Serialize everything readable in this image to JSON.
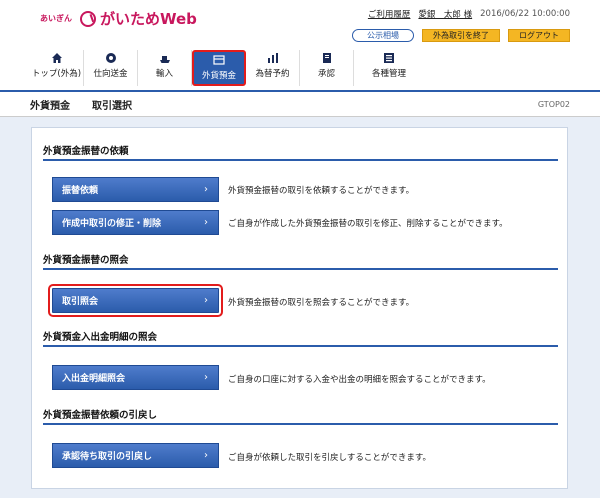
{
  "header": {
    "logo_small": "あいぎん",
    "logo_main": "がいためWeb",
    "history_link": "ご利用履歴",
    "user_name": "愛銀　太郎 様",
    "datetime": "2016/06/22 10:00:00",
    "rates_button": "公示相場",
    "end_fx_button": "外為取引を終了",
    "logout_button": "ログアウト"
  },
  "nav": {
    "items": [
      {
        "label": "トップ(外為)",
        "icon": "home-icon"
      },
      {
        "label": "仕向送金",
        "icon": "remittance-icon"
      },
      {
        "label": "輸入",
        "icon": "import-ship-icon"
      },
      {
        "label": "外貨預金",
        "icon": "deposit-icon"
      },
      {
        "label": "為替予約",
        "icon": "fx-contract-icon"
      },
      {
        "label": "承認",
        "icon": "approval-icon"
      },
      {
        "label": "各種管理",
        "icon": "management-icon"
      }
    ],
    "active_index": 3,
    "active_color": "#2b5cab",
    "highlight_color": "#e21c1c"
  },
  "title": {
    "section": "外貨預金",
    "page": "取引選択",
    "code": "GTOP02"
  },
  "sections": [
    {
      "title": "外貨預金振替の依頼",
      "actions": [
        {
          "label": "振替依頼",
          "desc": "外貨預金振替の取引を依頼することができます。"
        },
        {
          "label": "作成中取引の修正・削除",
          "desc": "ご自身が作成した外貨預金振替の取引を修正、削除することができます。"
        }
      ]
    },
    {
      "title": "外貨預金振替の照会",
      "actions": [
        {
          "label": "取引照会",
          "desc": "外貨預金振替の取引を照会することができます。"
        }
      ]
    },
    {
      "title": "外貨預金入出金明細の照会",
      "actions": [
        {
          "label": "入出金明細照会",
          "desc": "ご自身の口座に対する入金や出金の明細を照会することができます。"
        }
      ]
    },
    {
      "title": "外貨預金振替依頼の引戻し",
      "actions": [
        {
          "label": "承認待ち取引の引戻し",
          "desc": "ご自身が依頼した取引を引戻しすることができます。"
        }
      ]
    }
  ],
  "chevron": "›"
}
